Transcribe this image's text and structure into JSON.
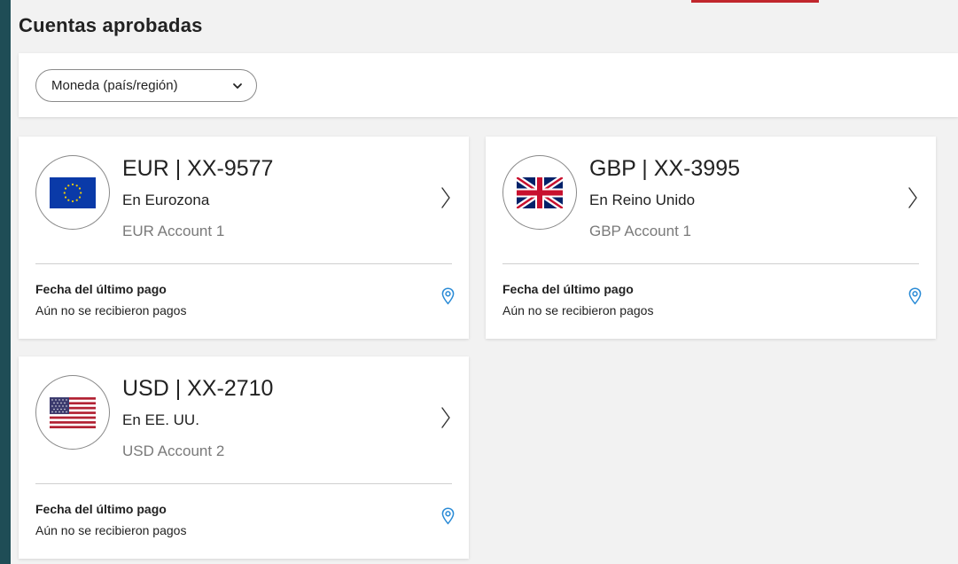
{
  "page": {
    "title": "Cuentas aprobadas"
  },
  "filter": {
    "dropdown_label": "Moneda (país/región)"
  },
  "accounts": [
    {
      "flag": "eu-flag-icon",
      "title": "EUR | XX-9577",
      "region": "En Eurozona",
      "name": "EUR Account 1",
      "last_payment_label": "Fecha del último pago",
      "last_payment_value": "Aún no se recibieron pagos"
    },
    {
      "flag": "uk-flag-icon",
      "title": "GBP | XX-3995",
      "region": "En Reino Unido",
      "name": "GBP Account 1",
      "last_payment_label": "Fecha del último pago",
      "last_payment_value": "Aún no se recibieron pagos"
    },
    {
      "flag": "us-flag-icon",
      "title": "USD | XX-2710",
      "region": "En EE. UU.",
      "name": "USD Account 2",
      "last_payment_label": "Fecha del último pago",
      "last_payment_value": "Aún no se recibieron pagos"
    }
  ],
  "colors": {
    "background": "#1f4d56",
    "panel": "#f2f2f2",
    "accent": "#c1272d",
    "icon_blue": "#2a8bd6",
    "muted_text": "#7a7a7a"
  }
}
